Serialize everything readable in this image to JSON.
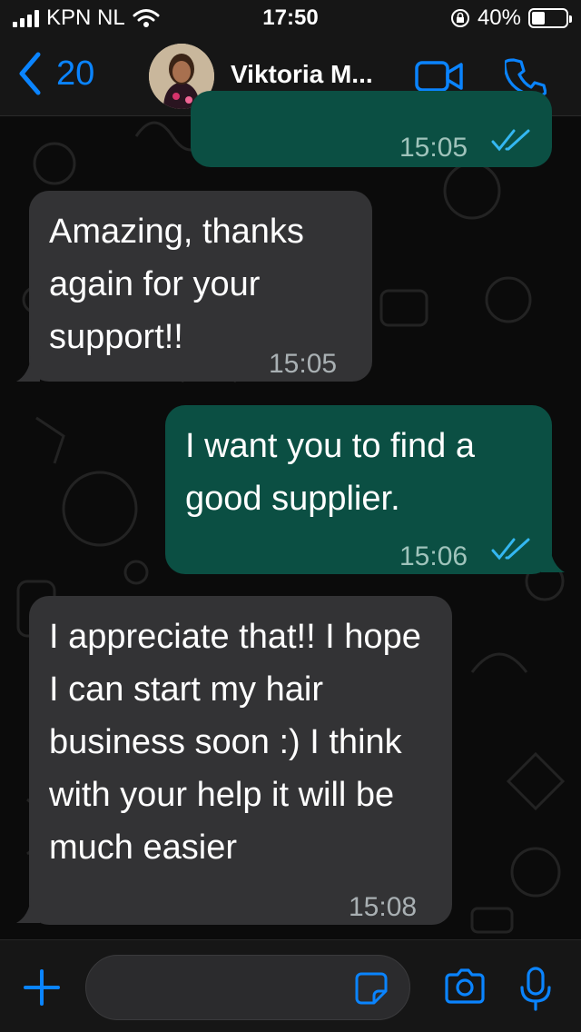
{
  "status_bar": {
    "carrier": "KPN NL",
    "time": "17:50",
    "battery": "40%",
    "battery_level": 0.4
  },
  "header": {
    "back_count": "20",
    "contact_name": "Viktoria M..."
  },
  "messages": [
    {
      "direction": "outgoing",
      "text": "",
      "time": "15:05",
      "read": true
    },
    {
      "direction": "incoming",
      "text": "Amazing, thanks again for your support!!",
      "time": "15:05"
    },
    {
      "direction": "outgoing",
      "text": "I want you to find a good supplier.",
      "time": "15:06",
      "read": true
    },
    {
      "direction": "incoming",
      "text": "I appreciate that!! I hope I can start my hair business soon :) I think with your help it will be much easier",
      "time": "15:08"
    }
  ],
  "input": {
    "value": "",
    "placeholder": ""
  },
  "colors": {
    "accent": "#0a84ff",
    "outgoing_bubble": "#0b4f43",
    "incoming_bubble": "#333335",
    "read_ticks": "#34b7f1"
  },
  "icons": [
    "back-chevron-icon",
    "video-call-icon",
    "phone-icon",
    "plus-icon",
    "sticker-icon",
    "camera-icon",
    "microphone-icon",
    "wifi-icon",
    "rotation-lock-icon"
  ]
}
